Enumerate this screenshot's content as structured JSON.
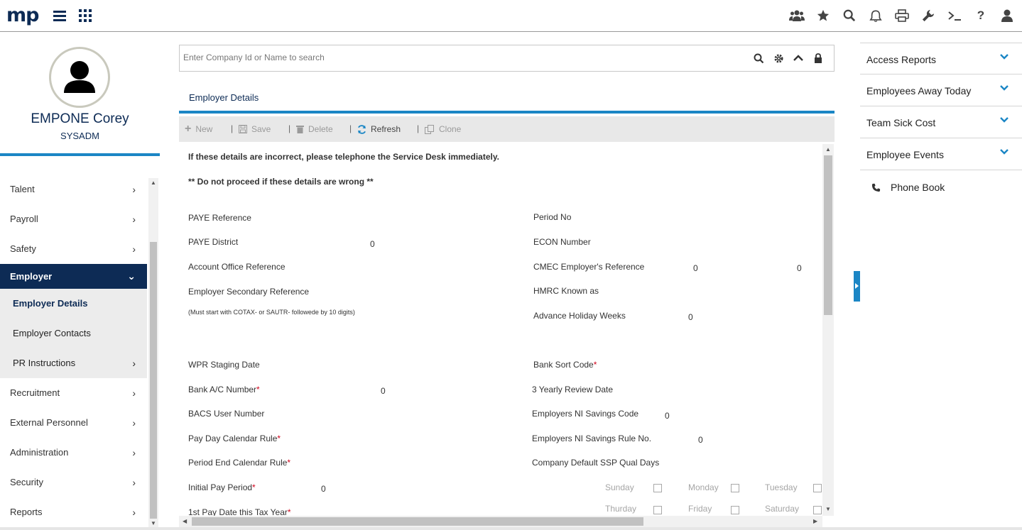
{
  "app": {
    "logo": "mp"
  },
  "topbar": {
    "right_icons": [
      "team-icon",
      "star-icon",
      "search-icon",
      "bell-icon",
      "print-icon",
      "wrench-icon",
      "terminal-icon",
      "help-icon",
      "user-icon"
    ]
  },
  "profile": {
    "name": "EMPONE Corey",
    "role": "SYSADM"
  },
  "nav": {
    "items": [
      {
        "label": "Talent"
      },
      {
        "label": "Payroll"
      },
      {
        "label": "Safety"
      },
      {
        "label": "Employer"
      },
      {
        "label": "Recruitment"
      },
      {
        "label": "External Personnel"
      },
      {
        "label": "Administration"
      },
      {
        "label": "Security"
      },
      {
        "label": "Reports"
      }
    ],
    "employer_sub": [
      {
        "label": "Employer Details"
      },
      {
        "label": "Employer Contacts"
      },
      {
        "label": "PR Instructions"
      }
    ]
  },
  "search": {
    "placeholder": "Enter Company Id or Name to search"
  },
  "panel": {
    "title": "Employer Details"
  },
  "toolbar": {
    "new": "New",
    "save": "Save",
    "delete": "Delete",
    "refresh": "Refresh",
    "clone": "Clone"
  },
  "form": {
    "notice1": "If these details are incorrect, please telephone the Service Desk immediately.",
    "notice2": "** Do not proceed if these details are wrong **",
    "left": {
      "paye_reference": "PAYE Reference",
      "paye_district": "PAYE District",
      "paye_district_val": "0",
      "account_office_ref": "Account Office Reference",
      "employer_secondary_ref": "Employer Secondary Reference",
      "secondary_hint": "(Must start with COTAX- or SAUTR- followede by 10 digits)",
      "wpr_staging_date": "WPR Staging Date",
      "bank_ac_number": "Bank A/C Number",
      "bank_ac_val": "0",
      "bacs_user_number": "BACS User Number",
      "pay_day_rule": "Pay Day Calendar Rule",
      "period_end_rule": "Period End Calendar Rule",
      "initial_pay_period": "Initial Pay Period",
      "initial_pay_val": "0",
      "first_pay_date": "1st Pay Date this Tax Year"
    },
    "right": {
      "period_no": "Period No",
      "econ_number": "ECON Number",
      "cmec_ref": "CMEC Employer's Reference",
      "cmec_val1": "0",
      "cmec_val2": "0",
      "hmrc_known_as": "HMRC Known as",
      "advance_holiday_weeks": "Advance Holiday Weeks",
      "advance_holiday_val": "0",
      "bank_sort_code": "Bank Sort Code",
      "three_yearly_review": "3 Yearly Review Date",
      "ni_savings_code": "Employers NI Savings Code",
      "ni_savings_code_val": "0",
      "ni_savings_rule": "Employers NI Savings Rule No.",
      "ni_savings_rule_val": "0",
      "ssp_qual_days": "Company Default SSP Qual Days",
      "days": {
        "sunday": "Sunday",
        "monday": "Monday",
        "tuesday": "Tuesday",
        "thursday": "Thurday",
        "friday": "Friday",
        "saturday": "Saturday"
      }
    },
    "required_mark": "*"
  },
  "right_panel": {
    "items": [
      {
        "label": "Access Reports"
      },
      {
        "label": "Employees Away Today"
      },
      {
        "label": "Team Sick Cost"
      },
      {
        "label": "Employee Events"
      }
    ],
    "phone_book": "Phone Book"
  },
  "colors": {
    "navy": "#0d2b55",
    "accent": "#1b86c5",
    "required": "#d0021b"
  }
}
